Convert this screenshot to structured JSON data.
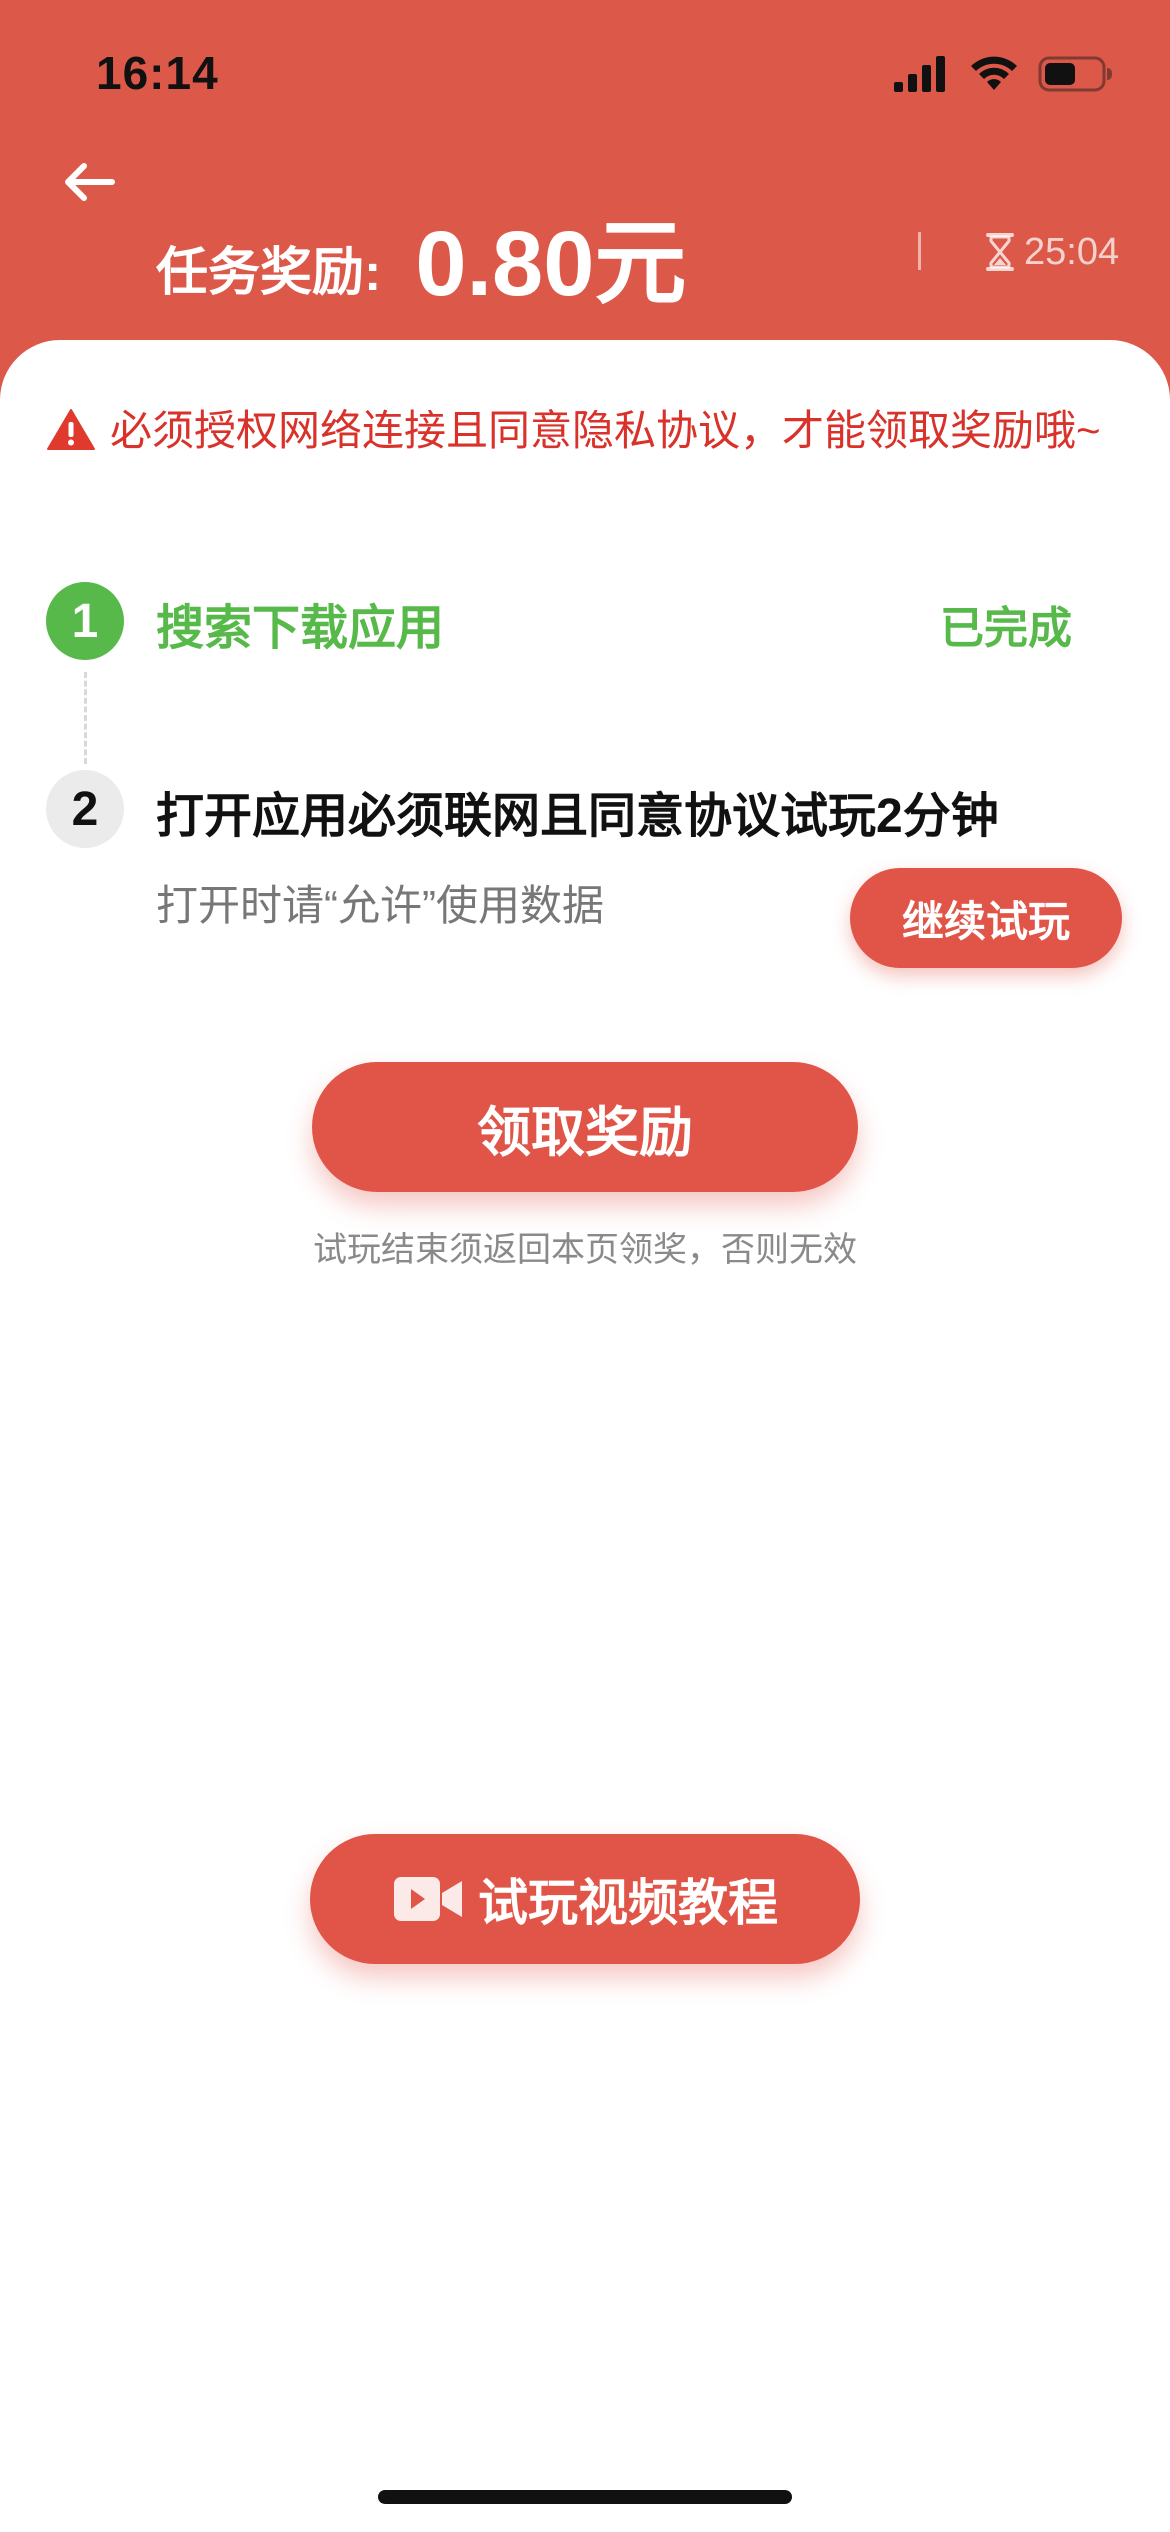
{
  "status_bar": {
    "time": "16:14",
    "icons": [
      "signal-icon",
      "wifi-icon",
      "battery-icon"
    ]
  },
  "header": {
    "back_icon": "arrow-left-icon",
    "reward_label": "任务奖励:",
    "reward_amount": "0.80元",
    "timer_icon": "hourglass-icon",
    "timer": "25:04"
  },
  "warning": {
    "icon": "warning-icon",
    "text": "必须授权网络连接且同意隐私协议，才能领取奖励哦~"
  },
  "steps": [
    {
      "number": "1",
      "title": "搜索下载应用",
      "status": "已完成"
    },
    {
      "number": "2",
      "title": "打开应用必须联网且同意协议试玩2分钟",
      "description": "打开时请“允许”使用数据",
      "action_label": "继续试玩"
    }
  ],
  "claim": {
    "button_label": "领取奖励",
    "note": "试玩结束须返回本页领奖，否则无效"
  },
  "tutorial": {
    "icon": "video-camera-icon",
    "button_label": "试玩视频教程"
  },
  "colors": {
    "header_red": "#dc594a",
    "button_red": "#e05548",
    "success_green": "#57b94a",
    "warning_red": "#d8322a"
  }
}
